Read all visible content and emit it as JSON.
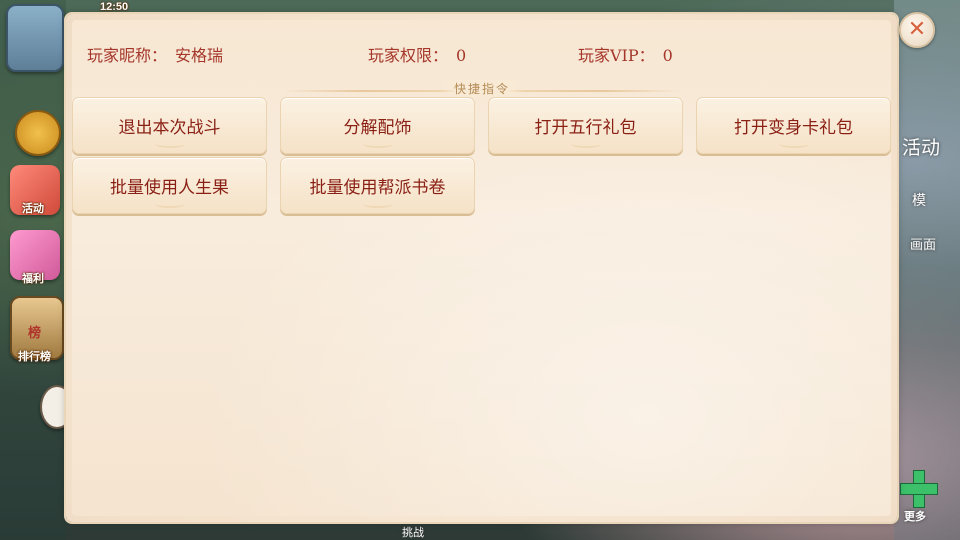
{
  "status": {
    "clock": "12:50"
  },
  "side_buttons": {
    "activity_label": "活动",
    "welfare_label": "福利",
    "ranking_label": "排行榜",
    "ranking_badge": "榜"
  },
  "right_hud": {
    "activity_label": "活动",
    "mode_label": "模",
    "screen_label": "画面",
    "more_label": "更多"
  },
  "bottom": {
    "center_label": "挑战"
  },
  "player_info": {
    "nickname_label": "玩家昵称：",
    "nickname_value": "安格瑞",
    "permission_label": "玩家权限：",
    "permission_value": "0",
    "vip_label": "玩家VIP：",
    "vip_value": "0"
  },
  "section_title": "快捷指令",
  "commands": [
    {
      "label": "退出本次战斗"
    },
    {
      "label": "分解配饰"
    },
    {
      "label": "打开五行礼包"
    },
    {
      "label": "打开变身卡礼包"
    },
    {
      "label": "批量使用人生果"
    },
    {
      "label": "批量使用帮派书卷"
    }
  ],
  "close": {
    "glyph": "✕"
  },
  "colors": {
    "label_red": "#a5362a",
    "button_text": "#8a1f14",
    "close_x": "#d8623f"
  }
}
